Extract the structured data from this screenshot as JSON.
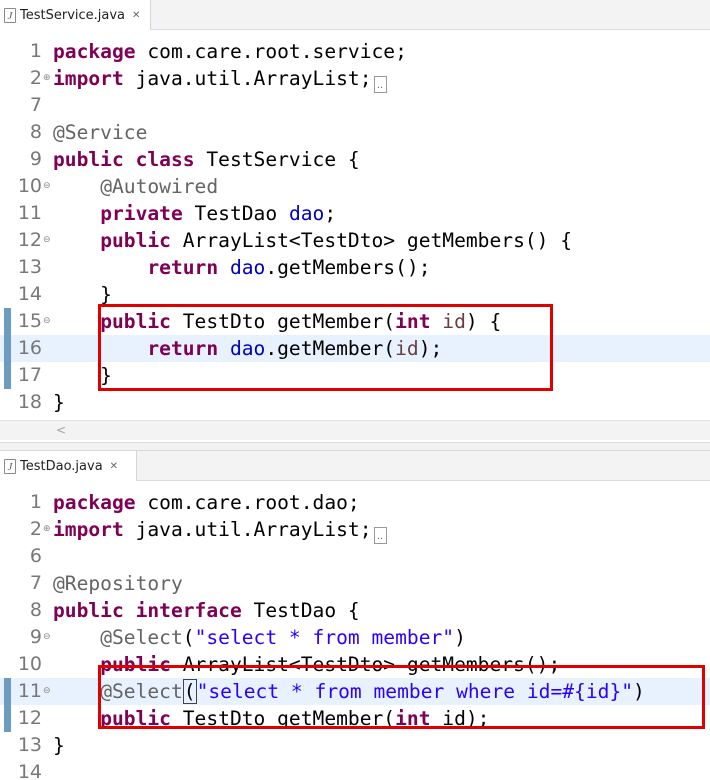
{
  "editor1": {
    "tab_label": "TestService.java",
    "lines": [
      {
        "num": "1",
        "html": "<span class=\"kw\">package</span> com.care.root.service;"
      },
      {
        "num": "2",
        "html": "<span class=\"kw\">import</span> java.util.ArrayList;<span class=\"ellipsis\">..</span>"
      },
      {
        "num": "7",
        "html": ""
      },
      {
        "num": "8",
        "html": "<span class=\"ann\">@Service</span>"
      },
      {
        "num": "9",
        "html": "<span class=\"kw\">public</span> <span class=\"kw\">class</span> TestService {"
      },
      {
        "num": "10",
        "html": "    <span class=\"ann\">@Autowired</span>"
      },
      {
        "num": "11",
        "html": "    <span class=\"kw\">private</span> TestDao <span class=\"fld\">dao</span>;"
      },
      {
        "num": "12",
        "html": "    <span class=\"kw\">public</span> ArrayList&lt;TestDto&gt; getMembers() {"
      },
      {
        "num": "13",
        "html": "        <span class=\"kw\">return</span> <span class=\"fld\">dao</span>.getMembers();"
      },
      {
        "num": "14",
        "html": "    }"
      },
      {
        "num": "15",
        "html": "    <span class=\"kw\">public</span> TestDto getMember(<span class=\"kw\">int</span> <span class=\"par\">id</span>) {"
      },
      {
        "num": "16",
        "html": "        <span class=\"kw\">return</span> <span class=\"fld\">dao</span>.getMember(<span class=\"par\">id</span>);"
      },
      {
        "num": "17",
        "html": "    }"
      },
      {
        "num": "18",
        "html": "}"
      }
    ]
  },
  "editor2": {
    "tab_label": "TestDao.java",
    "lines": [
      {
        "num": "1",
        "html": "<span class=\"kw\">package</span> com.care.root.dao;"
      },
      {
        "num": "2",
        "html": "<span class=\"kw\">import</span> java.util.ArrayList;<span class=\"ellipsis\">..</span>"
      },
      {
        "num": "6",
        "html": ""
      },
      {
        "num": "7",
        "html": "<span class=\"ann\">@Repository</span>"
      },
      {
        "num": "8",
        "html": "<span class=\"kw\">public</span> <span class=\"kw\">interface</span> TestDao {"
      },
      {
        "num": "9",
        "html": "    <span class=\"ann\">@Select</span>(<span class=\"str\">\"select * from member\"</span>)"
      },
      {
        "num": "10",
        "html": "    <span class=\"kw\">public</span> ArrayList&lt;TestDto&gt; getMembers();"
      },
      {
        "num": "11",
        "html": "    <span class=\"ann\">@Select</span><span class=\"bm\">(</span><span class=\"str\">\"select * from member where id=#{id}\"</span>)"
      },
      {
        "num": "12",
        "html": "    <span class=\"kw\">public</span> TestDto getMember(<span class=\"kw\">int</span> id);"
      },
      {
        "num": "13",
        "html": "}"
      },
      {
        "num": "14",
        "html": ""
      }
    ]
  },
  "icons": {
    "java_file": "java-file-icon",
    "close": "close-icon",
    "fold": "fold-collapse-icon",
    "scroll_left": "scroll-left-icon"
  },
  "colors": {
    "keyword": "#7f0055",
    "annotation": "#646464",
    "field": "#0000c0",
    "string": "#2a00ff",
    "parameter": "#6a3e3e",
    "highlight_box": "#e00000",
    "current_line": "#e8f2fe",
    "change_marker": "#6d9cc3"
  }
}
